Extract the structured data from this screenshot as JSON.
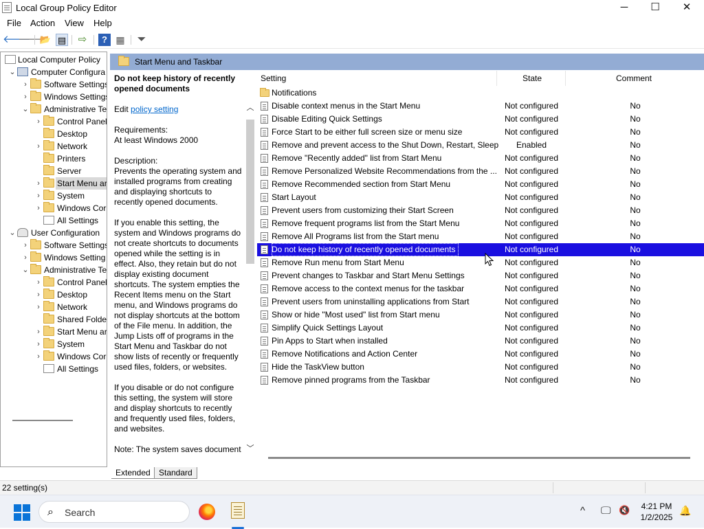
{
  "window": {
    "title": "Local Group Policy Editor",
    "minimize": "─",
    "maximize": "☐",
    "close": "✕"
  },
  "menu": [
    "File",
    "Action",
    "View",
    "Help"
  ],
  "toolbar": {
    "back": "🡐",
    "forward": "🡒",
    "up": "📂",
    "show_hide": "▤",
    "export": "⇨",
    "help": "?",
    "properties": "▦",
    "filter": "⏷"
  },
  "tree": [
    {
      "label": "Local Computer Policy",
      "level": 0,
      "icon": "policy-icon",
      "exp": ""
    },
    {
      "label": "Computer Configura",
      "level": 1,
      "icon": "computer-icon",
      "exp": "⌄"
    },
    {
      "label": "Software Settings",
      "level": 2,
      "icon": "folder-icon",
      "exp": "›"
    },
    {
      "label": "Windows Settings",
      "level": 2,
      "icon": "folder-icon",
      "exp": "›"
    },
    {
      "label": "Administrative Te",
      "level": 2,
      "icon": "folder-icon",
      "exp": "⌄"
    },
    {
      "label": "Control Panel",
      "level": 3,
      "icon": "folder-icon",
      "exp": "›"
    },
    {
      "label": "Desktop",
      "level": 3,
      "icon": "folder-icon",
      "exp": ""
    },
    {
      "label": "Network",
      "level": 3,
      "icon": "folder-icon",
      "exp": "›"
    },
    {
      "label": "Printers",
      "level": 3,
      "icon": "folder-icon",
      "exp": ""
    },
    {
      "label": "Server",
      "level": 3,
      "icon": "folder-icon",
      "exp": ""
    },
    {
      "label": "Start Menu ar",
      "level": 3,
      "icon": "folder-icon",
      "exp": "›",
      "selected": true
    },
    {
      "label": "System",
      "level": 3,
      "icon": "folder-icon",
      "exp": "›"
    },
    {
      "label": "Windows Cor",
      "level": 3,
      "icon": "folder-icon",
      "exp": "›"
    },
    {
      "label": "All Settings",
      "level": 3,
      "icon": "settings-icon",
      "exp": ""
    },
    {
      "label": "User Configuration",
      "level": 1,
      "icon": "user-icon",
      "exp": "⌄"
    },
    {
      "label": "Software Settings",
      "level": 2,
      "icon": "folder-icon",
      "exp": "›"
    },
    {
      "label": "Windows Setting",
      "level": 2,
      "icon": "folder-icon",
      "exp": "›"
    },
    {
      "label": "Administrative Te",
      "level": 2,
      "icon": "folder-icon",
      "exp": "⌄"
    },
    {
      "label": "Control Panel",
      "level": 3,
      "icon": "folder-icon",
      "exp": "›"
    },
    {
      "label": "Desktop",
      "level": 3,
      "icon": "folder-icon",
      "exp": "›"
    },
    {
      "label": "Network",
      "level": 3,
      "icon": "folder-icon",
      "exp": "›"
    },
    {
      "label": "Shared Folder",
      "level": 3,
      "icon": "folder-icon",
      "exp": ""
    },
    {
      "label": "Start Menu ar",
      "level": 3,
      "icon": "folder-icon",
      "exp": "›"
    },
    {
      "label": "System",
      "level": 3,
      "icon": "folder-icon",
      "exp": "›"
    },
    {
      "label": "Windows Cor",
      "level": 3,
      "icon": "folder-icon",
      "exp": "›"
    },
    {
      "label": "All Settings",
      "level": 3,
      "icon": "settings-icon",
      "exp": ""
    }
  ],
  "right_header": "Start Menu and Taskbar",
  "description": {
    "title": "Do not keep history of recently opened documents",
    "edit_prefix": "Edit ",
    "edit_link": "policy setting ",
    "requirements_label": "Requirements:",
    "requirements_value": "At least Windows 2000",
    "description_label": "Description:",
    "p1": "Prevents the operating system and installed programs from creating and displaying shortcuts to recently opened documents.",
    "p2": "If you enable this setting, the system and Windows programs do not create shortcuts to documents opened while the setting is in effect. Also, they retain but do not display existing document shortcuts. The system empties the Recent Items menu on the Start menu, and Windows programs do not display shortcuts at the bottom of the File menu. In addition, the Jump Lists off of programs in the Start Menu and Taskbar do not show lists of recently or frequently used files, folders, or websites.",
    "p3": "If you disable or do not configure this setting, the system will store and display shortcuts to recently and frequently used files, folders, and websites.",
    "p4": "Note: The system saves document"
  },
  "columns": {
    "setting": "Setting",
    "state": "State",
    "comment": "Comment"
  },
  "folder_row": "Notifications",
  "rows": [
    {
      "name": "Disable context menus in the Start Menu",
      "state": "Not configured",
      "comment": "No"
    },
    {
      "name": "Disable Editing Quick Settings",
      "state": "Not configured",
      "comment": "No"
    },
    {
      "name": "Force Start to be either full screen size or menu size",
      "state": "Not configured",
      "comment": "No"
    },
    {
      "name": "Remove and prevent access to the Shut Down, Restart, Sleep...",
      "state": "Enabled",
      "comment": "No"
    },
    {
      "name": "Remove \"Recently added\" list from Start Menu",
      "state": "Not configured",
      "comment": "No"
    },
    {
      "name": "Remove Personalized Website Recommendations from the ...",
      "state": "Not configured",
      "comment": "No"
    },
    {
      "name": "Remove Recommended section from Start Menu",
      "state": "Not configured",
      "comment": "No"
    },
    {
      "name": "Start Layout",
      "state": "Not configured",
      "comment": "No"
    },
    {
      "name": "Prevent users from customizing their Start Screen",
      "state": "Not configured",
      "comment": "No"
    },
    {
      "name": "Remove frequent programs list from the Start Menu",
      "state": "Not configured",
      "comment": "No"
    },
    {
      "name": "Remove All Programs list from the Start menu",
      "state": "Not configured",
      "comment": "No"
    },
    {
      "name": "Do not keep history of recently opened documents",
      "state": "Not configured",
      "comment": "No",
      "selected": true
    },
    {
      "name": "Remove Run menu from Start Menu",
      "state": "Not configured",
      "comment": "No"
    },
    {
      "name": "Prevent changes to Taskbar and Start Menu Settings",
      "state": "Not configured",
      "comment": "No"
    },
    {
      "name": "Remove access to the context menus for the taskbar",
      "state": "Not configured",
      "comment": "No"
    },
    {
      "name": "Prevent users from uninstalling applications from Start",
      "state": "Not configured",
      "comment": "No"
    },
    {
      "name": "Show or hide \"Most used\" list from Start menu",
      "state": "Not configured",
      "comment": "No"
    },
    {
      "name": "Simplify Quick Settings Layout",
      "state": "Not configured",
      "comment": "No"
    },
    {
      "name": "Pin Apps to Start when installed",
      "state": "Not configured",
      "comment": "No"
    },
    {
      "name": "Remove Notifications and Action Center",
      "state": "Not configured",
      "comment": "No"
    },
    {
      "name": "Hide the TaskView button",
      "state": "Not configured",
      "comment": "No"
    },
    {
      "name": "Remove pinned programs from the Taskbar",
      "state": "Not configured",
      "comment": "No"
    }
  ],
  "tabs": [
    "Extended",
    "Standard"
  ],
  "status": "22 setting(s)",
  "taskbar": {
    "search_placeholder": "Search",
    "time": "4:21 PM",
    "date": "1/2/2025",
    "chevron": "^",
    "network": "🖵",
    "volume": "🔇",
    "bell": "🔔"
  },
  "colors": {
    "selection": "#1a0fe0",
    "header": "#93acd4",
    "link": "#0066cc",
    "start": "#0a74d8"
  }
}
